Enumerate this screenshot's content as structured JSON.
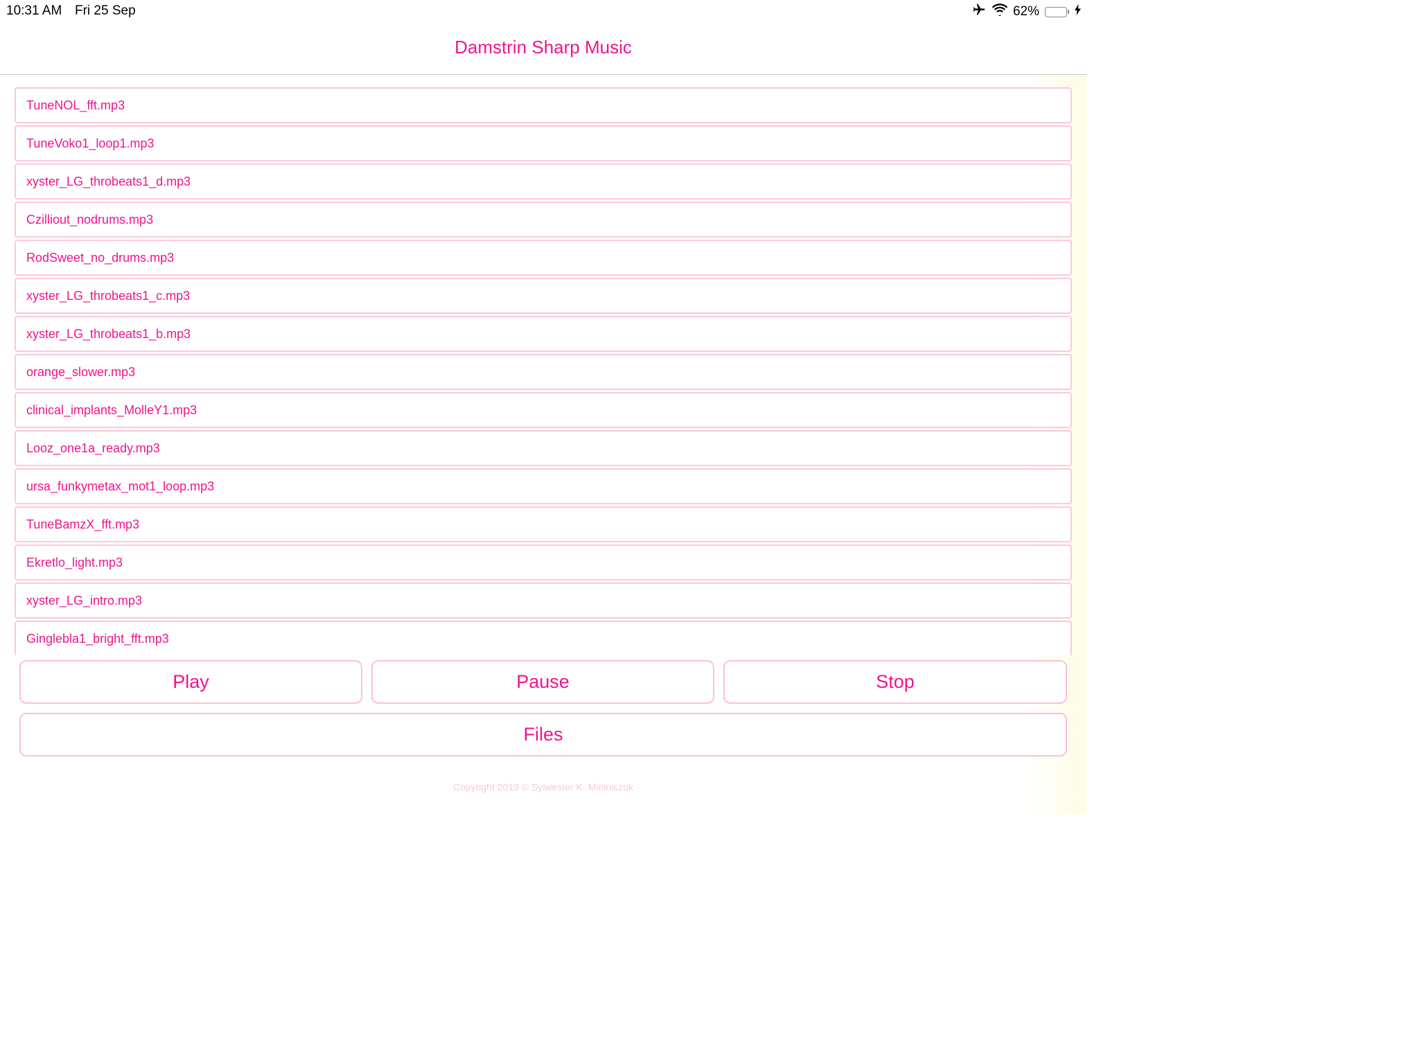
{
  "status_bar": {
    "time": "10:31 AM",
    "date": "Fri 25 Sep",
    "battery_percent": "62%",
    "battery_level": 0.62,
    "icons": [
      "airplane-icon",
      "wifi-icon",
      "battery-icon",
      "charging-icon"
    ]
  },
  "nav": {
    "title": "Damstrin Sharp Music"
  },
  "files": [
    "TuneNOL_fft.mp3",
    "TuneVoko1_loop1.mp3",
    "xyster_LG_throbeats1_d.mp3",
    "Czilliout_nodrums.mp3",
    "RodSweet_no_drums.mp3",
    "xyster_LG_throbeats1_c.mp3",
    "xyster_LG_throbeats1_b.mp3",
    "orange_slower.mp3",
    "clinical_implants_MolleY1.mp3",
    "Looz_one1a_ready.mp3",
    "ursa_funkymetax_mot1_loop.mp3",
    "TuneBamzX_fft.mp3",
    "Ekretlo_light.mp3",
    "xyster_LG_intro.mp3",
    "Gingleblа1_bright_fft.mp3"
  ],
  "controls": {
    "play": "Play",
    "pause": "Pause",
    "stop": "Stop",
    "files": "Files"
  },
  "footer": {
    "copyright": "Copyright 2019 © Sylwester K. Mielniczuk"
  },
  "colors": {
    "accent": "#f0148c",
    "border": "#fbc8dc",
    "footer_text": "#fcc8dc",
    "battery": "#34c759"
  }
}
